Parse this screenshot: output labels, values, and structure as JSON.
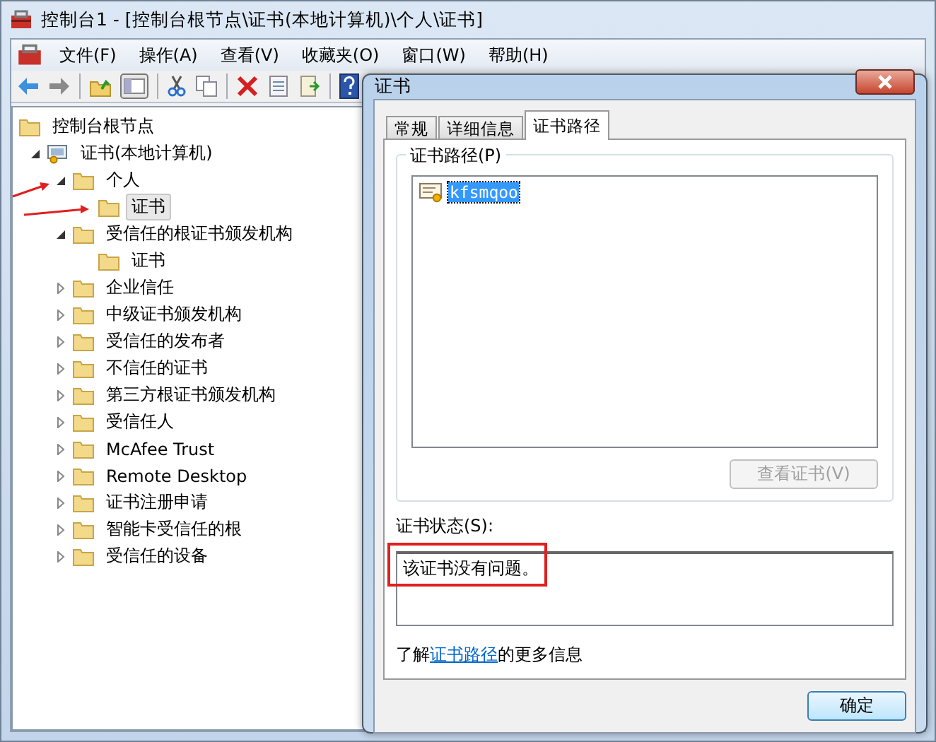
{
  "window": {
    "title": "控制台1 - [控制台根节点\\证书(本地计算机)\\个人\\证书]"
  },
  "menu": [
    "文件(F)",
    "操作(A)",
    "查看(V)",
    "收藏夹(O)",
    "窗口(W)",
    "帮助(H)"
  ],
  "tree": [
    {
      "label": "控制台根节点",
      "kind": "folder",
      "selected": false,
      "children": [
        {
          "label": "证书(本地计算机)",
          "kind": "store",
          "expanded": true,
          "selected": false,
          "children": [
            {
              "label": "个人",
              "kind": "folder",
              "expanded": true,
              "selected": false,
              "children": [
                {
                  "label": "证书",
                  "kind": "folder",
                  "selected": true
                }
              ]
            },
            {
              "label": "受信任的根证书颁发机构",
              "kind": "folder",
              "expanded": true,
              "selected": false,
              "children": [
                {
                  "label": "证书",
                  "kind": "folder",
                  "selected": false
                }
              ]
            },
            {
              "label": "企业信任",
              "kind": "folder",
              "expanded": false,
              "selected": false
            },
            {
              "label": "中级证书颁发机构",
              "kind": "folder",
              "expanded": false,
              "selected": false
            },
            {
              "label": "受信任的发布者",
              "kind": "folder",
              "expanded": false,
              "selected": false
            },
            {
              "label": "不信任的证书",
              "kind": "folder",
              "expanded": false,
              "selected": false
            },
            {
              "label": "第三方根证书颁发机构",
              "kind": "folder",
              "expanded": false,
              "selected": false
            },
            {
              "label": "受信任人",
              "kind": "folder",
              "expanded": false,
              "selected": false
            },
            {
              "label": "McAfee Trust",
              "kind": "folder",
              "expanded": false,
              "selected": false
            },
            {
              "label": "Remote Desktop",
              "kind": "folder",
              "expanded": false,
              "selected": false
            },
            {
              "label": "证书注册申请",
              "kind": "folder",
              "expanded": false,
              "selected": false
            },
            {
              "label": "智能卡受信任的根",
              "kind": "folder",
              "expanded": false,
              "selected": false
            },
            {
              "label": "受信任的设备",
              "kind": "folder",
              "expanded": false,
              "selected": false
            }
          ]
        }
      ]
    }
  ],
  "dialog": {
    "title": "证书",
    "tabs": [
      {
        "label": "常规",
        "selected": false
      },
      {
        "label": "详细信息",
        "selected": false
      },
      {
        "label": "证书路径",
        "selected": true
      }
    ],
    "path_group": {
      "label": "证书路径(P)",
      "items": [
        {
          "label": "kfsmqoo",
          "selected": true
        }
      ],
      "button": {
        "label": "查看证书(V)",
        "disabled": true
      }
    },
    "status": {
      "label": "证书状态(S):",
      "value": "该证书没有问题。"
    },
    "learn_more": {
      "before": "了解",
      "link": "证书路径",
      "after": "的更多信息"
    },
    "ok_button": "确定"
  }
}
